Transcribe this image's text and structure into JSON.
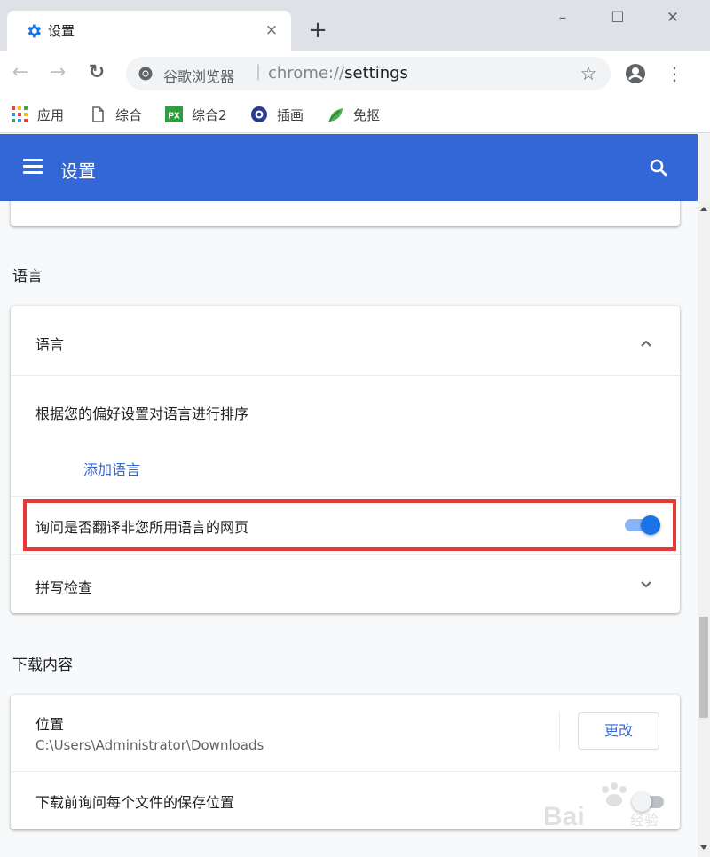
{
  "tab": {
    "title": "设置",
    "close_glyph": "×"
  },
  "newtab_glyph": "+",
  "window": {
    "minimize": "–",
    "maximize": "☐",
    "close": "✕"
  },
  "toolbar": {
    "site_name": "谷歌浏览器",
    "url_scheme": "chrome://",
    "url_path": "settings",
    "back_glyph": "←",
    "forward_glyph": "→",
    "reload_glyph": "↻",
    "star_glyph": "☆",
    "menu_glyph": "⋮"
  },
  "bookmarks": [
    {
      "label": "应用",
      "icon": "apps-grid-icon"
    },
    {
      "label": "综合",
      "icon": "page-icon"
    },
    {
      "label": "综合2",
      "icon": "px-icon",
      "badge": "PX"
    },
    {
      "label": "插画",
      "icon": "circle-logo-icon"
    },
    {
      "label": "免抠",
      "icon": "leaf-icon"
    }
  ],
  "header": {
    "title": "设置",
    "color": "#3367d6"
  },
  "sections": {
    "language": {
      "title": "语言",
      "row_title": "语言",
      "sort_hint": "根据您的偏好设置对语言进行排序",
      "add_language": "添加语言",
      "translate_prompt": "询问是否翻译非您所用语言的网页",
      "translate_enabled": true,
      "spellcheck": "拼写检查"
    },
    "downloads": {
      "title": "下载内容",
      "location_label": "位置",
      "location_path": "C:\\Users\\Administrator\\Downloads",
      "change_button": "更改",
      "ask_where_to_save": "下载前询问每个文件的保存位置"
    }
  },
  "watermark": "Bai 经验",
  "colors": {
    "accent": "#1a73e8",
    "highlight": "#e53935",
    "link": "#3367d6"
  }
}
